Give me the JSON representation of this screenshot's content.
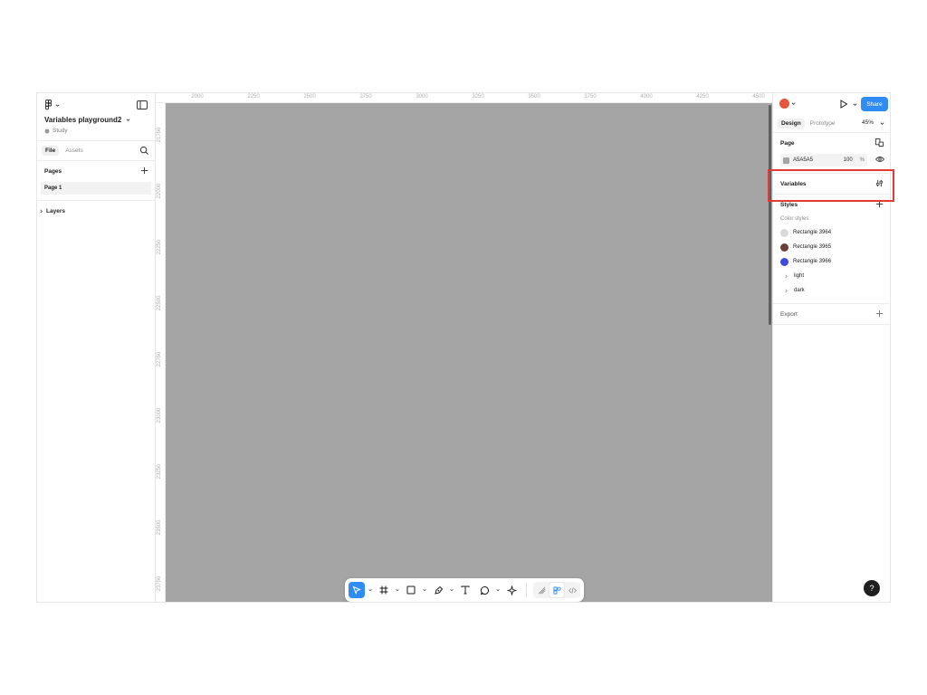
{
  "file": {
    "name": "Variables playground2",
    "project": "Study"
  },
  "left_tabs": [
    "File",
    "Assets"
  ],
  "pages": {
    "title": "Pages",
    "items": [
      "Page 1"
    ]
  },
  "layers": {
    "title": "Layers"
  },
  "ruler_x": [
    "2000",
    "2250",
    "2500",
    "2750",
    "3000",
    "3250",
    "3500",
    "3750",
    "4000",
    "4250",
    "4500"
  ],
  "ruler_y": [
    "21750",
    "22000",
    "22250",
    "22500",
    "22750",
    "23000",
    "23250",
    "23500",
    "23750"
  ],
  "canvas": {
    "background": "#A5A5A5"
  },
  "right": {
    "share_label": "Share",
    "design_tab": "Design",
    "prototype_tab": "Prototype",
    "zoom": "45%",
    "page_section": "Page",
    "page_bg_hex": "A5A5A5",
    "page_bg_opacity": "100",
    "page_bg_pct": "%",
    "variables_section": "Variables",
    "styles_section": "Styles",
    "color_styles_label": "Color styles",
    "styles": [
      {
        "name": "Rectangle 3964",
        "color": "#D9D9D9"
      },
      {
        "name": "Rectangle 3965",
        "color": "#6B3F3A"
      },
      {
        "name": "Rectangle 3966",
        "color": "#3D4BD8"
      }
    ],
    "groups": [
      "light",
      "dark"
    ],
    "export_section": "Export"
  },
  "help_label": "?",
  "colors": {
    "accent": "#2F8CF3",
    "highlight": "#E53935"
  }
}
